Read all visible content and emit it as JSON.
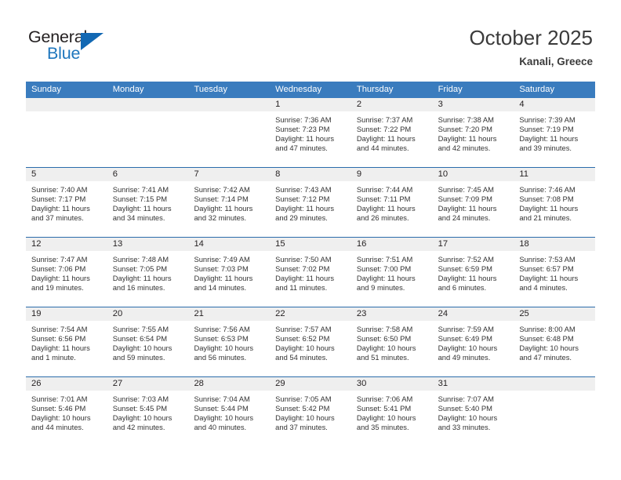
{
  "brand": {
    "name_part1": "General",
    "name_part2": "Blue",
    "accent_color": "#1268b3"
  },
  "header": {
    "title": "October 2025",
    "location": "Kanali, Greece"
  },
  "calendar": {
    "header_bg": "#3a7cbe",
    "date_band_bg": "#efefef",
    "weekdays": [
      "Sunday",
      "Monday",
      "Tuesday",
      "Wednesday",
      "Thursday",
      "Friday",
      "Saturday"
    ],
    "weeks": [
      [
        {
          "date": "",
          "empty": true
        },
        {
          "date": "",
          "empty": true
        },
        {
          "date": "",
          "empty": true
        },
        {
          "date": "1",
          "sunrise": "Sunrise: 7:36 AM",
          "sunset": "Sunset: 7:23 PM",
          "daylight_line1": "Daylight: 11 hours",
          "daylight_line2": "and 47 minutes."
        },
        {
          "date": "2",
          "sunrise": "Sunrise: 7:37 AM",
          "sunset": "Sunset: 7:22 PM",
          "daylight_line1": "Daylight: 11 hours",
          "daylight_line2": "and 44 minutes."
        },
        {
          "date": "3",
          "sunrise": "Sunrise: 7:38 AM",
          "sunset": "Sunset: 7:20 PM",
          "daylight_line1": "Daylight: 11 hours",
          "daylight_line2": "and 42 minutes."
        },
        {
          "date": "4",
          "sunrise": "Sunrise: 7:39 AM",
          "sunset": "Sunset: 7:19 PM",
          "daylight_line1": "Daylight: 11 hours",
          "daylight_line2": "and 39 minutes."
        }
      ],
      [
        {
          "date": "5",
          "sunrise": "Sunrise: 7:40 AM",
          "sunset": "Sunset: 7:17 PM",
          "daylight_line1": "Daylight: 11 hours",
          "daylight_line2": "and 37 minutes."
        },
        {
          "date": "6",
          "sunrise": "Sunrise: 7:41 AM",
          "sunset": "Sunset: 7:15 PM",
          "daylight_line1": "Daylight: 11 hours",
          "daylight_line2": "and 34 minutes."
        },
        {
          "date": "7",
          "sunrise": "Sunrise: 7:42 AM",
          "sunset": "Sunset: 7:14 PM",
          "daylight_line1": "Daylight: 11 hours",
          "daylight_line2": "and 32 minutes."
        },
        {
          "date": "8",
          "sunrise": "Sunrise: 7:43 AM",
          "sunset": "Sunset: 7:12 PM",
          "daylight_line1": "Daylight: 11 hours",
          "daylight_line2": "and 29 minutes."
        },
        {
          "date": "9",
          "sunrise": "Sunrise: 7:44 AM",
          "sunset": "Sunset: 7:11 PM",
          "daylight_line1": "Daylight: 11 hours",
          "daylight_line2": "and 26 minutes."
        },
        {
          "date": "10",
          "sunrise": "Sunrise: 7:45 AM",
          "sunset": "Sunset: 7:09 PM",
          "daylight_line1": "Daylight: 11 hours",
          "daylight_line2": "and 24 minutes."
        },
        {
          "date": "11",
          "sunrise": "Sunrise: 7:46 AM",
          "sunset": "Sunset: 7:08 PM",
          "daylight_line1": "Daylight: 11 hours",
          "daylight_line2": "and 21 minutes."
        }
      ],
      [
        {
          "date": "12",
          "sunrise": "Sunrise: 7:47 AM",
          "sunset": "Sunset: 7:06 PM",
          "daylight_line1": "Daylight: 11 hours",
          "daylight_line2": "and 19 minutes."
        },
        {
          "date": "13",
          "sunrise": "Sunrise: 7:48 AM",
          "sunset": "Sunset: 7:05 PM",
          "daylight_line1": "Daylight: 11 hours",
          "daylight_line2": "and 16 minutes."
        },
        {
          "date": "14",
          "sunrise": "Sunrise: 7:49 AM",
          "sunset": "Sunset: 7:03 PM",
          "daylight_line1": "Daylight: 11 hours",
          "daylight_line2": "and 14 minutes."
        },
        {
          "date": "15",
          "sunrise": "Sunrise: 7:50 AM",
          "sunset": "Sunset: 7:02 PM",
          "daylight_line1": "Daylight: 11 hours",
          "daylight_line2": "and 11 minutes."
        },
        {
          "date": "16",
          "sunrise": "Sunrise: 7:51 AM",
          "sunset": "Sunset: 7:00 PM",
          "daylight_line1": "Daylight: 11 hours",
          "daylight_line2": "and 9 minutes."
        },
        {
          "date": "17",
          "sunrise": "Sunrise: 7:52 AM",
          "sunset": "Sunset: 6:59 PM",
          "daylight_line1": "Daylight: 11 hours",
          "daylight_line2": "and 6 minutes."
        },
        {
          "date": "18",
          "sunrise": "Sunrise: 7:53 AM",
          "sunset": "Sunset: 6:57 PM",
          "daylight_line1": "Daylight: 11 hours",
          "daylight_line2": "and 4 minutes."
        }
      ],
      [
        {
          "date": "19",
          "sunrise": "Sunrise: 7:54 AM",
          "sunset": "Sunset: 6:56 PM",
          "daylight_line1": "Daylight: 11 hours",
          "daylight_line2": "and 1 minute."
        },
        {
          "date": "20",
          "sunrise": "Sunrise: 7:55 AM",
          "sunset": "Sunset: 6:54 PM",
          "daylight_line1": "Daylight: 10 hours",
          "daylight_line2": "and 59 minutes."
        },
        {
          "date": "21",
          "sunrise": "Sunrise: 7:56 AM",
          "sunset": "Sunset: 6:53 PM",
          "daylight_line1": "Daylight: 10 hours",
          "daylight_line2": "and 56 minutes."
        },
        {
          "date": "22",
          "sunrise": "Sunrise: 7:57 AM",
          "sunset": "Sunset: 6:52 PM",
          "daylight_line1": "Daylight: 10 hours",
          "daylight_line2": "and 54 minutes."
        },
        {
          "date": "23",
          "sunrise": "Sunrise: 7:58 AM",
          "sunset": "Sunset: 6:50 PM",
          "daylight_line1": "Daylight: 10 hours",
          "daylight_line2": "and 51 minutes."
        },
        {
          "date": "24",
          "sunrise": "Sunrise: 7:59 AM",
          "sunset": "Sunset: 6:49 PM",
          "daylight_line1": "Daylight: 10 hours",
          "daylight_line2": "and 49 minutes."
        },
        {
          "date": "25",
          "sunrise": "Sunrise: 8:00 AM",
          "sunset": "Sunset: 6:48 PM",
          "daylight_line1": "Daylight: 10 hours",
          "daylight_line2": "and 47 minutes."
        }
      ],
      [
        {
          "date": "26",
          "sunrise": "Sunrise: 7:01 AM",
          "sunset": "Sunset: 5:46 PM",
          "daylight_line1": "Daylight: 10 hours",
          "daylight_line2": "and 44 minutes."
        },
        {
          "date": "27",
          "sunrise": "Sunrise: 7:03 AM",
          "sunset": "Sunset: 5:45 PM",
          "daylight_line1": "Daylight: 10 hours",
          "daylight_line2": "and 42 minutes."
        },
        {
          "date": "28",
          "sunrise": "Sunrise: 7:04 AM",
          "sunset": "Sunset: 5:44 PM",
          "daylight_line1": "Daylight: 10 hours",
          "daylight_line2": "and 40 minutes."
        },
        {
          "date": "29",
          "sunrise": "Sunrise: 7:05 AM",
          "sunset": "Sunset: 5:42 PM",
          "daylight_line1": "Daylight: 10 hours",
          "daylight_line2": "and 37 minutes."
        },
        {
          "date": "30",
          "sunrise": "Sunrise: 7:06 AM",
          "sunset": "Sunset: 5:41 PM",
          "daylight_line1": "Daylight: 10 hours",
          "daylight_line2": "and 35 minutes."
        },
        {
          "date": "31",
          "sunrise": "Sunrise: 7:07 AM",
          "sunset": "Sunset: 5:40 PM",
          "daylight_line1": "Daylight: 10 hours",
          "daylight_line2": "and 33 minutes."
        },
        {
          "date": "",
          "empty": true
        }
      ]
    ]
  }
}
